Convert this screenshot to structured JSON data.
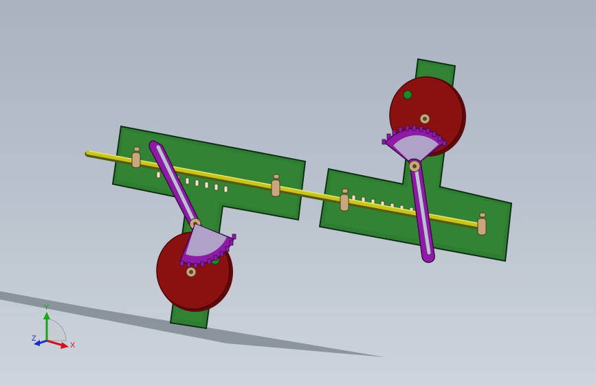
{
  "triad": {
    "x_label": "X",
    "y_label": "Y",
    "z_label": "Z",
    "colors": {
      "x": "#d0121b",
      "y": "#1aa71a",
      "z": "#1a2cc9"
    }
  },
  "colors": {
    "background": "#b7c0cb",
    "plate": "#2e7d32",
    "disc": "#8b1010",
    "linkage": "#8e1ba6",
    "shaft": "#c8c41a",
    "bearing": "#c9a77a"
  }
}
